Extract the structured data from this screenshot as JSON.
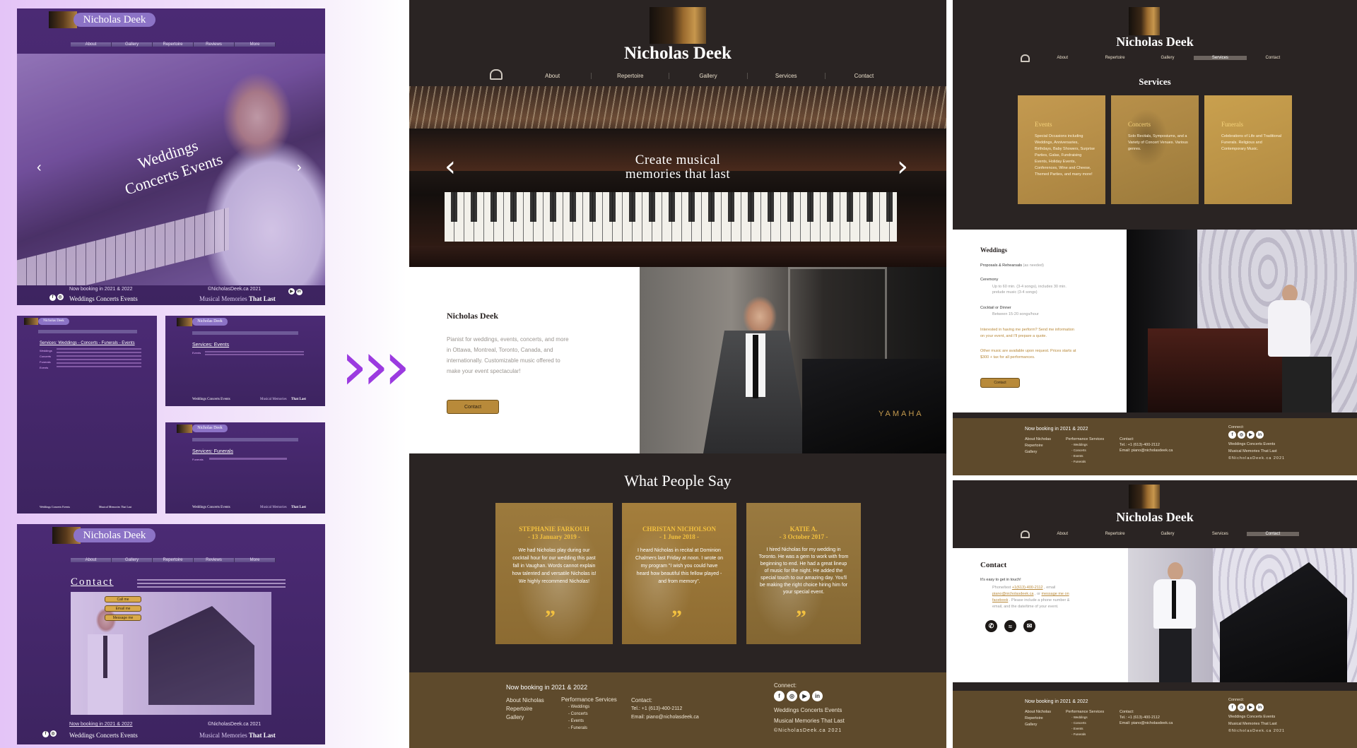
{
  "left_panel": {
    "main_mock": {
      "brand": "Nicholas Deek",
      "nav": [
        "About",
        "Gallery",
        "Repertoire",
        "Reviews",
        "More"
      ],
      "hero_line1": "Weddings",
      "hero_line2": "Concerts Events",
      "booking": "Now booking in 2021 & 2022",
      "copyright": "©NicholasDeek.ca 2021",
      "footer_left": "Weddings Concerts Events",
      "footer_right_a": "Musical Memories",
      "footer_right_b": "That Last"
    },
    "services_mock_a": {
      "brand": "Nicholas Deek",
      "heading": "Services: Weddings - Concerts - Funerals - Events",
      "list": [
        "Weddings",
        "Concerts",
        "Funerals",
        "Events"
      ],
      "footer_left": "Weddings Concerts Events",
      "footer_right": "Musical Memories That Last"
    },
    "services_mock_b": {
      "brand": "Nicholas Deek",
      "heading": "Services: Events",
      "list": [
        "Events"
      ],
      "footer_left": "Weddings Concerts Events",
      "footer_right_a": "Musical Memories",
      "footer_right_b": "That Last"
    },
    "services_mock_c": {
      "brand": "Nicholas Deek",
      "heading": "Services: Funerals",
      "list": [
        "Funerals"
      ],
      "footer_left": "Weddings Concerts Events",
      "footer_right_a": "Musical Memories",
      "footer_right_b": "That Last"
    },
    "contact_mock": {
      "brand": "Nicholas Deek",
      "nav": [
        "About",
        "Gallery",
        "Repertoire",
        "Reviews",
        "More"
      ],
      "heading": "Contact",
      "buttons": [
        "Call me",
        "Email me",
        "Message me"
      ],
      "booking": "Now booking in 2021 & 2022",
      "copyright": "©NicholasDeek.ca 2021",
      "footer_left": "Weddings Concerts Events",
      "footer_right_a": "Musical Memories",
      "footer_right_b": "That Last"
    }
  },
  "arrows": "›››",
  "center": {
    "brand": "Nicholas Deek",
    "nav": [
      "About",
      "Repertoire",
      "Gallery",
      "Services",
      "Contact"
    ],
    "hero_line1": "Create musical",
    "hero_line2": "memories that last",
    "about_title": "Nicholas Deek",
    "about_text": "Pianist for weddings, events, concerts, and more in Ottawa, Montreal, Toronto, Canada, and internationally. Customizable music offered to make your event spectacular!",
    "contact_button": "Contact",
    "yamaha": "YAMAHA",
    "testimonials_title": "What People Say",
    "testimonials": [
      {
        "name": "STEPHANIE FARKOUH",
        "date": "- 13 January 2019 -",
        "text": "We had Nicholas play during our cocktail hour for our wedding this past fall in Vaughan. Words cannot explain how talented and versatile Nicholas is! We highly recommend Nicholas!"
      },
      {
        "name": "CHRISTAN NICHOLSON",
        "date": "- 1 June 2018 -",
        "text": "I heard Nicholas in recital at Dominion Chalmers last Friday at noon. I wrote on my program \"I wish you could have heard how beautiful this fellow played - and from memory\"."
      },
      {
        "name": "KATIE A.",
        "date": "- 3 October 2017 -",
        "text": "I hired Nicholas for my wedding in Toronto. He was a gem to work with from beginning to end. He had a great lineup of music for the night. He added the special touch to our amazing day. You'll be making the right choice hiring him for your special event."
      }
    ],
    "footer": {
      "booking": "Now booking in 2021 & 2022",
      "links": [
        "About Nicholas",
        "Repertoire",
        "Gallery"
      ],
      "perf_title": "Performance Services",
      "perf_items": [
        "- Weddings",
        "- Concerts",
        "- Events",
        "- Funerals"
      ],
      "contact_title": "Contact:",
      "tel": "Tel.: +1 (613)-400-2112",
      "email": "Email: piano@nicholasdeek.ca",
      "connect": "Connect:",
      "tagline1": "Weddings Concerts Events",
      "tagline2": "Musical Memories That Last",
      "copyright": "©NicholasDeek.ca 2021"
    }
  },
  "right_services": {
    "brand": "Nicholas Deek",
    "nav": [
      "About",
      "Repertoire",
      "Gallery",
      "Services",
      "Contact"
    ],
    "active": "Services",
    "title": "Services",
    "cards": [
      {
        "title": "Events",
        "text": "Special Occasions including Weddings, Anniversaries, Birthdays, Baby Showers, Surprise Parties, Galas, Fundraising Events, Holiday Events, Conferences, Wine and Cheese, Themed Parties, and many more!"
      },
      {
        "title": "Concerts",
        "text": "Solo Recitals, Symposiums, and a Variety of Concert Venues. Various genres."
      },
      {
        "title": "Funerals",
        "text": "Celebrations of Life and Traditional Funerals. Religious and Contemporary Music."
      }
    ],
    "weddings": {
      "title": "Weddings",
      "proposal": "Proposals & Rehearsals",
      "proposal_note": "(as needed)",
      "ceremony": "Ceremony",
      "ceremony_note": "Up to 60 min. (3-4 songs), includes 30 min. prelude music (3-4 songs)",
      "cocktail": "Cocktail or Dinner",
      "cocktail_note": "Between 15-20 songs/hour",
      "interested": "Interested in having me perform? Send me information on your event, and I'll prepare a quote.",
      "other": "Other music are available upon request. Prices starts at $300 + tax for all performances.",
      "button": "Contact"
    },
    "footer": {
      "booking": "Now booking in 2021 & 2022",
      "links": [
        "About Nicholas",
        "Repertoire",
        "Gallery"
      ],
      "perf_title": "Performance Services",
      "perf_items": [
        "- Weddings",
        "- Concerts",
        "- Events",
        "- Funerals"
      ],
      "contact_title": "Contact:",
      "tel": "Tel.: +1 (613)-400-2112",
      "email": "Email: piano@nicholasdeek.ca",
      "connect": "Connect:",
      "tagline1": "Weddings Concerts Events",
      "tagline2": "Musical Memories That Last",
      "copyright": "©NicholasDeek.ca 2021"
    }
  },
  "right_contact": {
    "brand": "Nicholas Deek",
    "nav": [
      "About",
      "Repertoire",
      "Gallery",
      "Services",
      "Contact"
    ],
    "active": "Contact",
    "title": "Contact",
    "intro": "It's easy to get in touch!",
    "body_a": "Phone/text",
    "phone": "+1(613)-400-2112",
    "body_b": ", email",
    "email_link": "piano@nicholasdeek.ca",
    "body_c": ", or",
    "msg_link": "message me on facebook",
    "body_d": ". Please include a phone number & email, and the date/time of your event.",
    "footer": {
      "booking": "Now booking in 2021 & 2022",
      "links": [
        "About Nicholas",
        "Repertoire",
        "Gallery"
      ],
      "perf_title": "Performance Services",
      "perf_items": [
        "- Weddings",
        "- Concerts",
        "- Events",
        "- Funerals"
      ],
      "contact_title": "Contact:",
      "tel": "Tel.: +1 (613)-400-2112",
      "email": "Email: piano@nicholasdeek.ca",
      "connect": "Connect:",
      "tagline1": "Weddings Concerts Events",
      "tagline2": "Musical Memories That Last",
      "copyright": "©NicholasDeek.ca 2021"
    }
  },
  "colors": {
    "dark_brown": "#2a2423",
    "footer_gold": "#5e4a2c",
    "gold_accent": "#d2b062",
    "purple": "#4b2a74"
  },
  "icons": [
    "piano-logo-icon",
    "home-piano-icon",
    "chevron-left-icon",
    "chevron-right-icon",
    "quote-icon",
    "facebook-icon",
    "instagram-icon",
    "youtube-icon",
    "linkedin-icon",
    "phone-icon",
    "messenger-icon",
    "email-icon"
  ]
}
